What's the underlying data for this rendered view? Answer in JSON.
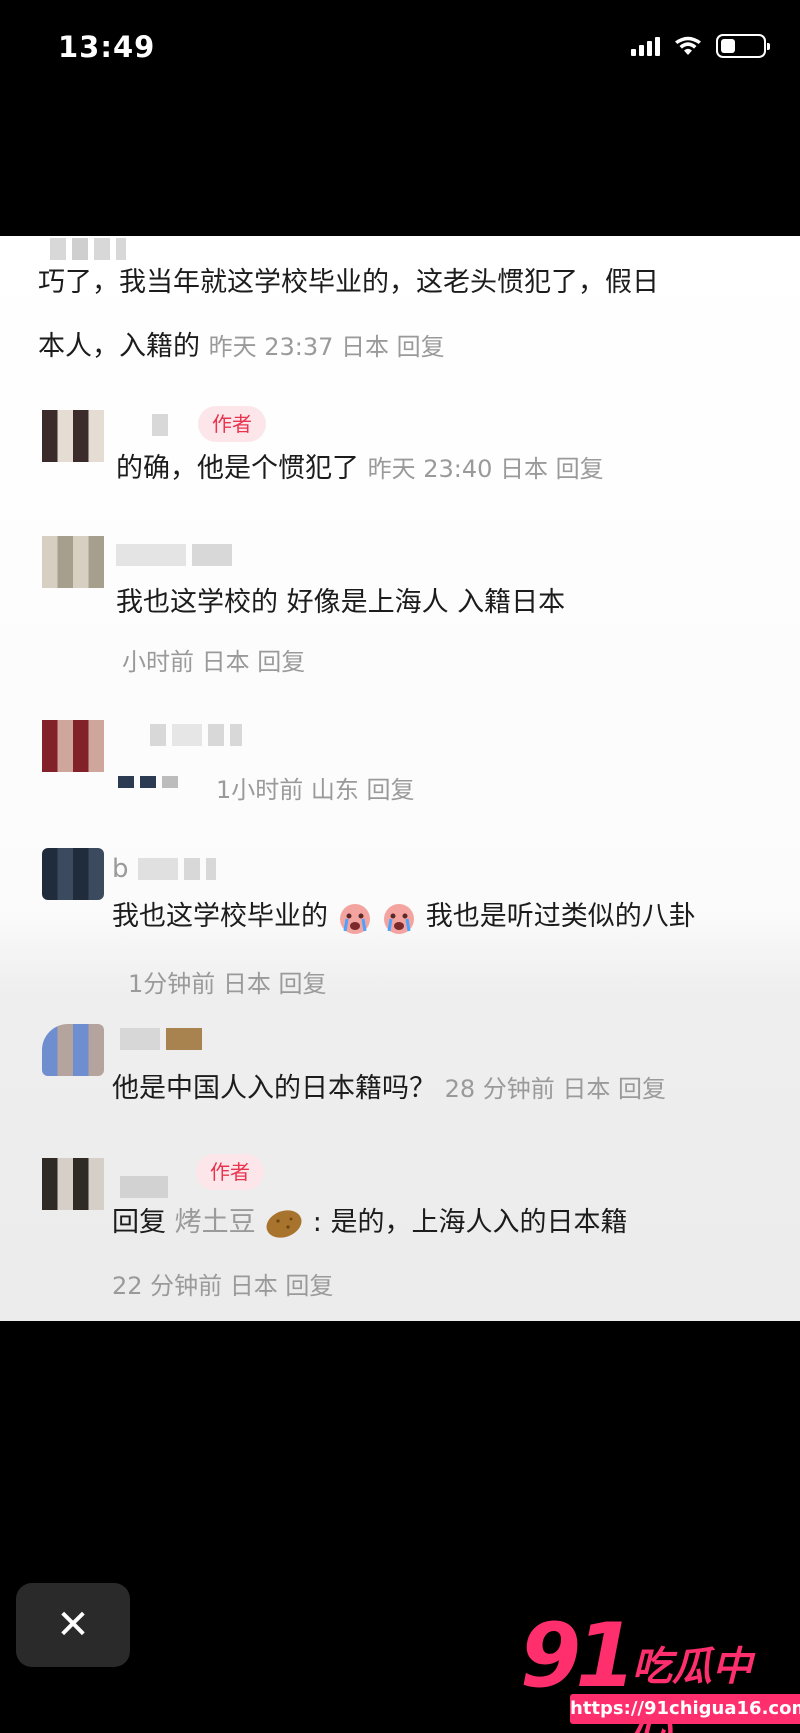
{
  "status_bar": {
    "time": "13:49"
  },
  "comments": [
    {
      "text": "巧了，我当年就这学校毕业的，这老头惯犯了，假日",
      "text2": "本人，入籍的",
      "meta": "昨天 23:37 日本 回复"
    },
    {
      "author_badge": "作者",
      "text": "的确，他是个惯犯了",
      "meta": "昨天 23:40 日本 回复"
    },
    {
      "text": "我也这学校的 好像是上海人 入籍日本",
      "meta": "小时前 日本 回复"
    },
    {
      "meta": "1小时前 山东 回复"
    },
    {
      "name": "b",
      "text_a": "我也这学校毕业的",
      "text_b": "我也是听过类似的八卦",
      "meta": "1分钟前 日本 回复"
    },
    {
      "text": "他是中国人入的日本籍吗？",
      "meta": "28 分钟前 日本 回复"
    },
    {
      "author_badge": "作者",
      "reply_prefix": "回复",
      "reply_to": "烤土豆",
      "text": ": 是的，上海人入的日本籍",
      "meta": "22 分钟前 日本 回复"
    }
  ],
  "close_button": "✕",
  "watermark": {
    "number": "91",
    "name": "吃瓜中心",
    "url": "https://91chigua16.com"
  }
}
